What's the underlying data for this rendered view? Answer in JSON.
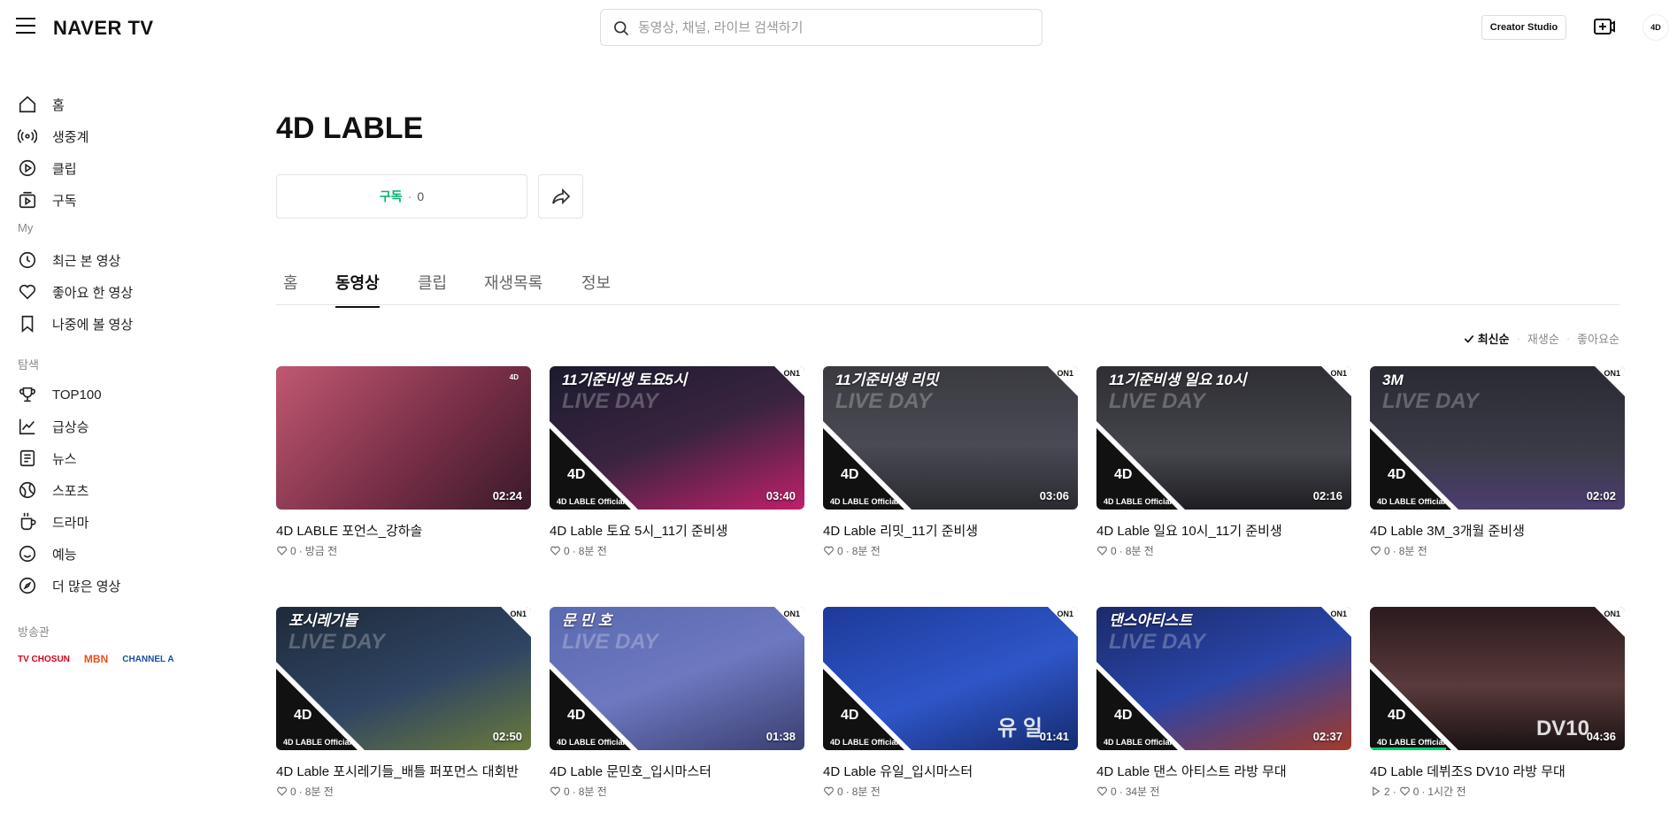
{
  "header": {
    "logo": "NAVER TV",
    "search_placeholder": "동영상, 채널, 라이브 검색하기",
    "creator_studio": "Creator Studio",
    "avatar_text": "4D"
  },
  "sidebar": {
    "main_items": [
      {
        "label": "홈",
        "icon": "home-icon"
      },
      {
        "label": "생중계",
        "icon": "live-icon"
      },
      {
        "label": "클립",
        "icon": "clip-icon"
      },
      {
        "label": "구독",
        "icon": "subscribe-icon"
      }
    ],
    "my_title": "My",
    "my_items": [
      {
        "label": "최근 본 영상",
        "icon": "history-icon"
      },
      {
        "label": "좋아요 한 영상",
        "icon": "heart-icon"
      },
      {
        "label": "나중에 볼 영상",
        "icon": "bookmark-icon"
      }
    ],
    "explore_title": "탐색",
    "explore_items": [
      {
        "label": "TOP100",
        "icon": "trophy-icon"
      },
      {
        "label": "급상승",
        "icon": "trending-icon"
      },
      {
        "label": "뉴스",
        "icon": "news-icon"
      },
      {
        "label": "스포츠",
        "icon": "sports-icon"
      },
      {
        "label": "드라마",
        "icon": "drama-icon"
      },
      {
        "label": "예능",
        "icon": "entertainment-icon"
      },
      {
        "label": "더 많은 영상",
        "icon": "compass-icon"
      }
    ],
    "broadcast_title": "방송관",
    "broadcasters": [
      "TV CHOSUN",
      "MBN",
      "CHANNEL A"
    ]
  },
  "channel": {
    "title": "4D LABLE",
    "subscribe_label": "구독",
    "subscribe_count": "0"
  },
  "tabs": [
    "홈",
    "동영상",
    "클립",
    "재생목록",
    "정보"
  ],
  "active_tab": "동영상",
  "sort": {
    "active": "최신순",
    "options": [
      "재생순",
      "좋아요순"
    ]
  },
  "colors": {
    "accent_green": "#00b46e",
    "text_primary": "#111111",
    "text_secondary": "#666666"
  },
  "videos": [
    {
      "title": "4D LABLE 포언스_강하솔",
      "likes": "0",
      "time": "방금 전",
      "duration": "02:24",
      "caption": "",
      "overlay": ""
    },
    {
      "title": "4D Lable 토요 5시_11기 준비생",
      "likes": "0",
      "time": "8분 전",
      "duration": "03:40",
      "caption": "11기준비생 토요5시",
      "overlay": "LIVE DAY"
    },
    {
      "title": "4D Lable 리밋_11기 준비생",
      "likes": "0",
      "time": "8분 전",
      "duration": "03:06",
      "caption": "11기준비생 리밋",
      "overlay": "LIVE DAY"
    },
    {
      "title": "4D Lable 일요 10시_11기 준비생",
      "likes": "0",
      "time": "8분 전",
      "duration": "02:16",
      "caption": "11기준비생 일요 10시",
      "overlay": "LIVE DAY"
    },
    {
      "title": "4D Lable 3M_3개월 준비생",
      "likes": "0",
      "time": "8분 전",
      "duration": "02:02",
      "caption": "3M",
      "overlay": "LIVE DAY"
    },
    {
      "title": "4D Lable 포시레기들_배틀 퍼포먼스 대회반",
      "likes": "0",
      "time": "8분 전",
      "duration": "02:50",
      "caption": "포시레기들",
      "overlay": "LIVE DAY"
    },
    {
      "title": "4D Lable 문민호_입시마스터",
      "likes": "0",
      "time": "8분 전",
      "duration": "01:38",
      "caption": "문 민 호",
      "overlay": "LIVE DAY"
    },
    {
      "title": "4D Lable 유일_입시마스터",
      "likes": "0",
      "time": "8분 전",
      "duration": "01:41",
      "caption": "",
      "overlay": "유 일"
    },
    {
      "title": "4D Lable 댄스 아티스트 라방 무대",
      "likes": "0",
      "time": "34분 전",
      "duration": "02:37",
      "caption": "댄스아티스트",
      "overlay": "LIVE DAY"
    },
    {
      "title": "4D Lable 데뷔조S DV10 라방 무대",
      "plays": "2",
      "likes": "0",
      "time": "1시간 전",
      "duration": "04:36",
      "caption": "",
      "overlay": "DV10",
      "progress": 0.3
    }
  ],
  "thumb_badge": {
    "corner": "ON1",
    "official": "4D LABLE Official",
    "mark": "4D"
  }
}
